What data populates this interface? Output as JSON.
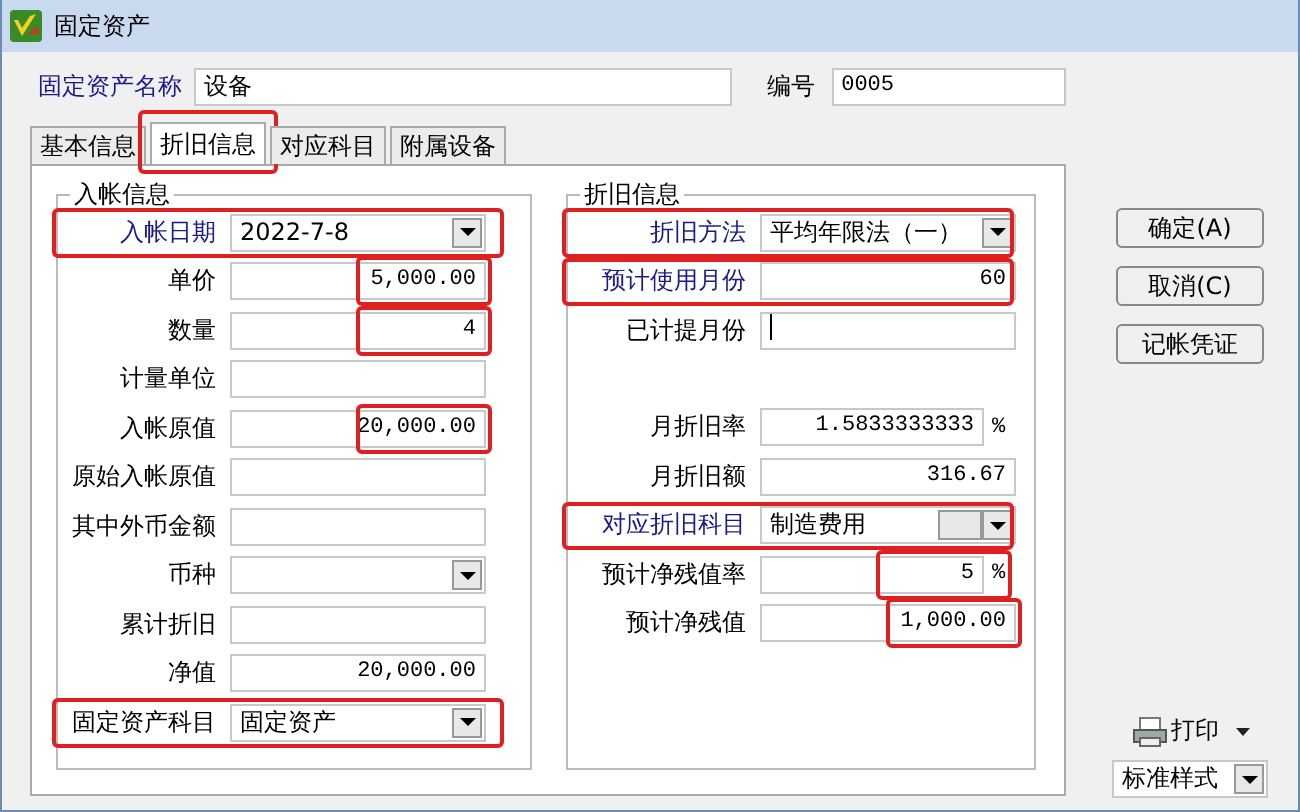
{
  "window": {
    "title": "固定资产"
  },
  "header": {
    "name_label": "固定资产名称",
    "name_value": "设备",
    "code_label": "编号",
    "code_value": "0005"
  },
  "tabs": [
    {
      "label": "基本信息",
      "selected": false,
      "highlighted": false
    },
    {
      "label": "折旧信息",
      "selected": true,
      "highlighted": true
    },
    {
      "label": "对应科目",
      "selected": false,
      "highlighted": false
    },
    {
      "label": "附属设备",
      "selected": false,
      "highlighted": false
    }
  ],
  "groups": [
    {
      "title": "入帐信息",
      "fields": [
        {
          "label": "入帐日期",
          "link": true,
          "kind": "combo",
          "value": "2022-7-8",
          "row_highlighted": true
        },
        {
          "label": "单价",
          "link": false,
          "kind": "text",
          "value": "5,000.00",
          "value_highlighted": true
        },
        {
          "label": "数量",
          "link": false,
          "kind": "text",
          "value": "4",
          "value_highlighted": true
        },
        {
          "label": "计量单位",
          "link": false,
          "kind": "text"
        },
        {
          "label": "入帐原值",
          "link": false,
          "kind": "text",
          "value": "20,000.00",
          "value_highlighted": true
        },
        {
          "label": "原始入帐原值",
          "link": false,
          "kind": "text"
        },
        {
          "label": "其中外币金额",
          "link": false,
          "kind": "text"
        },
        {
          "label": "币种",
          "link": false,
          "kind": "combo"
        },
        {
          "label": "累计折旧",
          "link": false,
          "kind": "text"
        },
        {
          "label": "净值",
          "link": false,
          "kind": "text",
          "value": "20,000.00"
        },
        {
          "label": "固定资产科目",
          "link": false,
          "kind": "combo",
          "value": "固定资产",
          "row_highlighted": true
        }
      ]
    },
    {
      "title": "折旧信息",
      "fields": [
        {
          "label": "折旧方法",
          "link": true,
          "kind": "combo",
          "value": "平均年限法（一）",
          "row_highlighted": true
        },
        {
          "label": "预计使用月份",
          "link": true,
          "kind": "text",
          "value": "60",
          "row_highlighted": true
        },
        {
          "label": "已计提月份",
          "link": false,
          "kind": "text",
          "caret": true
        },
        {
          "label": "月折旧率",
          "link": false,
          "kind": "text",
          "value": "1.5833333333",
          "unit": "%",
          "group_break": true
        },
        {
          "label": "月折旧额",
          "link": false,
          "kind": "text",
          "value": "316.67"
        },
        {
          "label": "对应折旧科目",
          "link": true,
          "kind": "lookup",
          "value": "制造费用",
          "row_highlighted": true
        },
        {
          "label": "预计净残值率",
          "link": false,
          "kind": "text",
          "value": "5",
          "unit": "%",
          "value_highlighted": true
        },
        {
          "label": "预计净残值",
          "link": false,
          "kind": "text",
          "value": "1,000.00",
          "value_highlighted": true
        }
      ]
    }
  ],
  "buttons": [
    "确定(A)",
    "取消(C)",
    "记帐凭证"
  ],
  "print": {
    "label": "打印",
    "style": "标准样式"
  }
}
